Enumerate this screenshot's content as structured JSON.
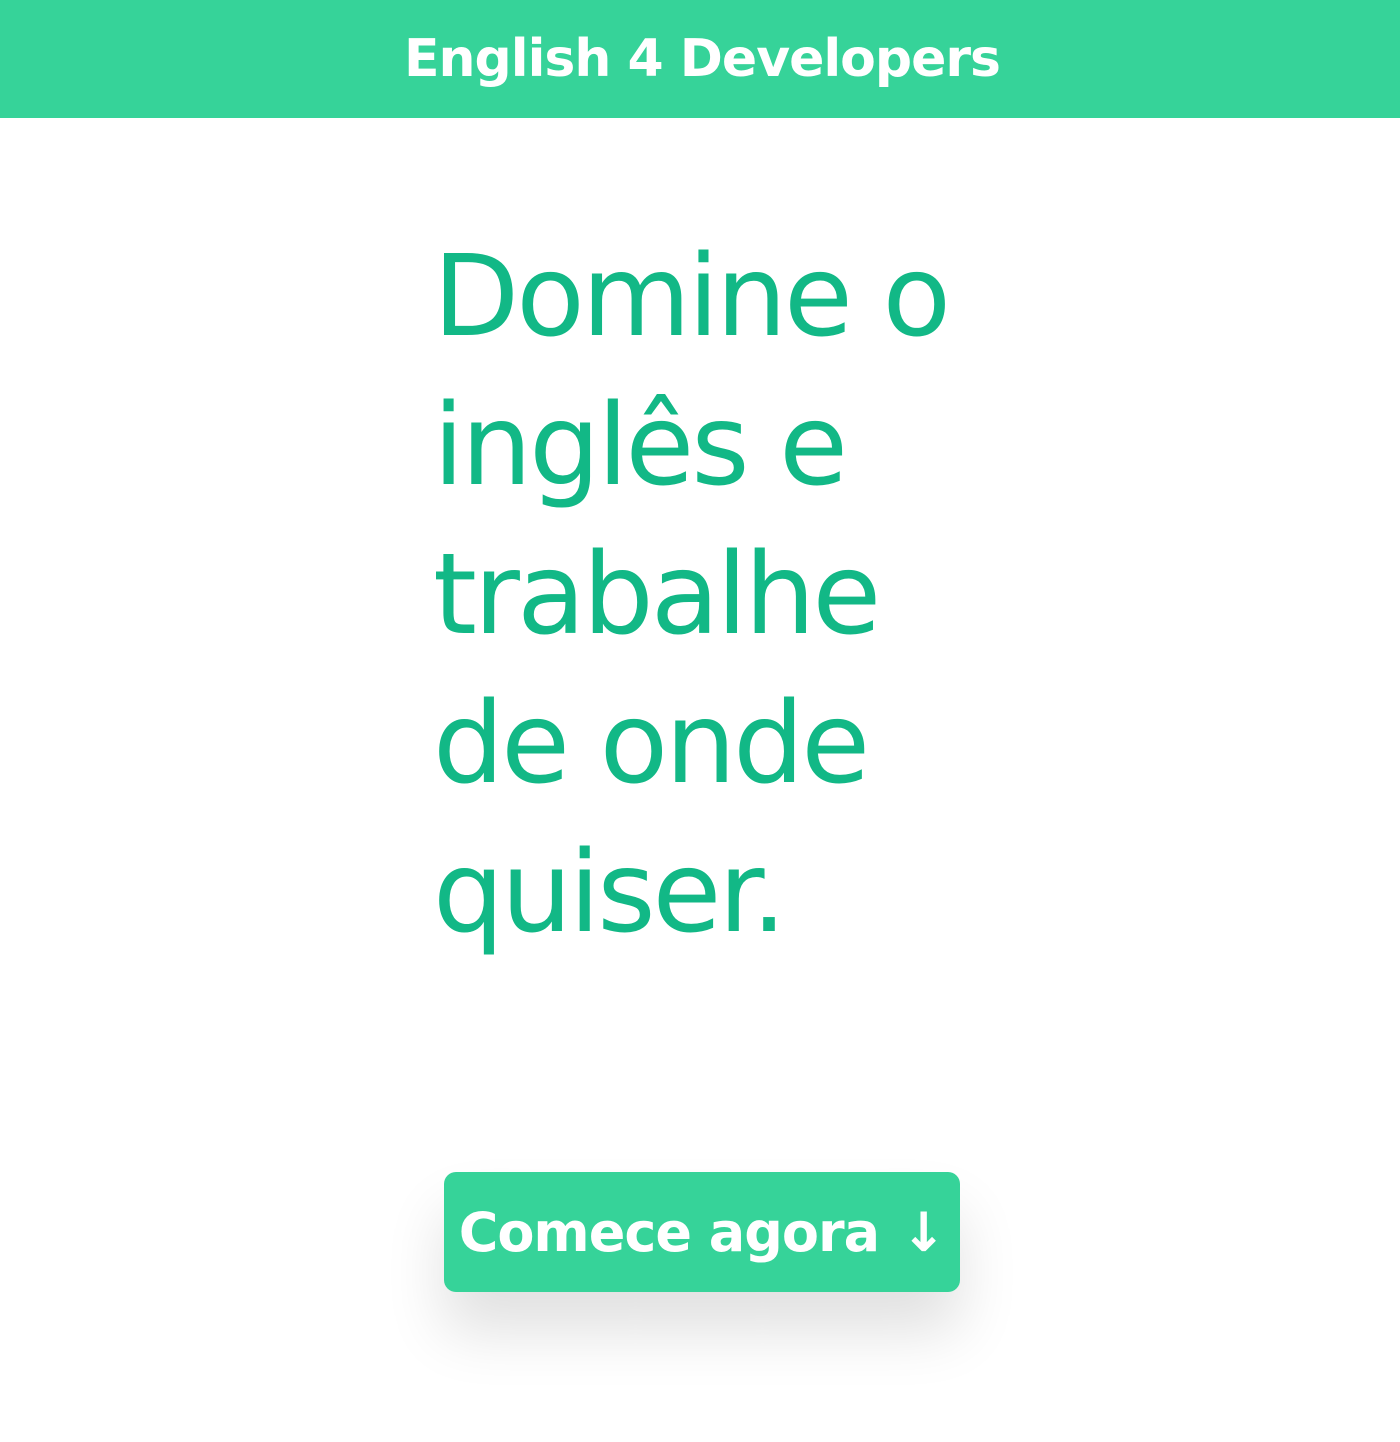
{
  "header": {
    "brand": "English 4 Developers",
    "background_color": "#36d399"
  },
  "hero": {
    "title_lines": [
      "Domine o",
      "inglês e",
      "trabalhe",
      "de onde",
      "quiser."
    ],
    "title_color": "#12b886"
  },
  "cta": {
    "label": "Comece agora",
    "icon": "↓",
    "icon_name": "arrow-down-icon",
    "background_color": "#36d399"
  }
}
